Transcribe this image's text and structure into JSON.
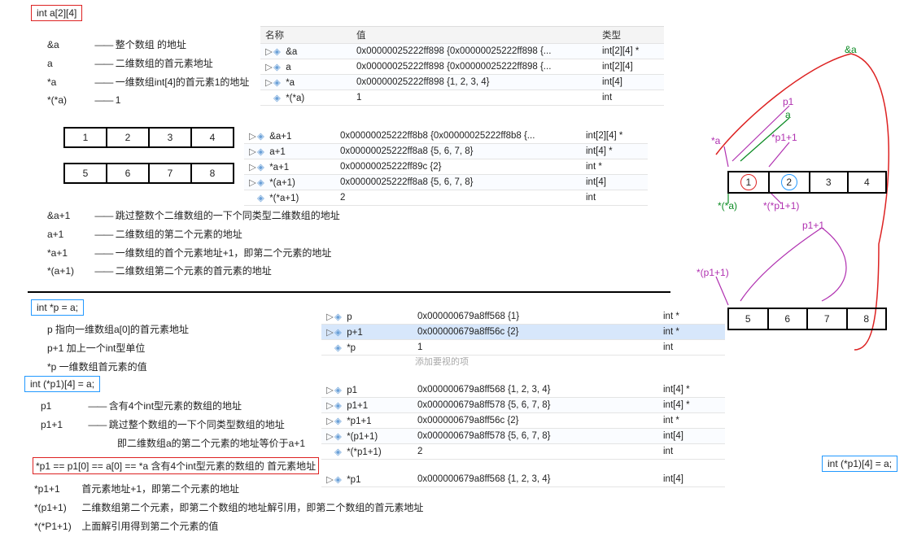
{
  "decl1": "int a[2][4]",
  "notes1": {
    "r1": {
      "sym": "&a",
      "dash": "——",
      "txt": "整个数组 的地址"
    },
    "r2": {
      "sym": "a",
      "dash": "——",
      "txt": "二维数组的首元素地址"
    },
    "r3": {
      "sym": "*a",
      "dash": "——",
      "txt": "一维数组int[4]的首元素1的地址"
    },
    "r4": {
      "sym": "*(*a)",
      "dash": "——",
      "txt": "1"
    }
  },
  "grid_a": [
    "1",
    "2",
    "3",
    "4"
  ],
  "grid_b": [
    "5",
    "6",
    "7",
    "8"
  ],
  "watch1": {
    "head": {
      "name": "名称",
      "val": "值",
      "type": "类型"
    },
    "rows": [
      {
        "name": "&a",
        "val": "0x00000025222ff898 {0x00000025222ff898 {...",
        "type": "int[2][4] *"
      },
      {
        "name": "a",
        "val": "0x00000025222ff898 {0x00000025222ff898 {...",
        "type": "int[2][4]"
      },
      {
        "name": "*a",
        "val": "0x00000025222ff898 {1, 2, 3, 4}",
        "type": "int[4]"
      },
      {
        "name": "*(*a)",
        "val": "1",
        "type": "int"
      }
    ]
  },
  "watch2": {
    "rows": [
      {
        "name": "&a+1",
        "val": "0x00000025222ff8b8 {0x00000025222ff8b8 {...",
        "type": "int[2][4] *"
      },
      {
        "name": "a+1",
        "val": "0x00000025222ff8a8 {5, 6, 7, 8}",
        "type": "int[4] *"
      },
      {
        "name": "*a+1",
        "val": "0x00000025222ff89c {2}",
        "type": "int *"
      },
      {
        "name": "*(a+1)",
        "val": "0x00000025222ff8a8 {5, 6, 7, 8}",
        "type": "int[4]"
      },
      {
        "name": "*(*a+1)",
        "val": "2",
        "type": "int"
      }
    ]
  },
  "notes2": {
    "r1": {
      "sym": "&a+1",
      "dash": "——",
      "txt": "跳过整数个二维数组的一下个同类型二维数组的地址"
    },
    "r2": {
      "sym": "a+1",
      "dash": "——",
      "txt": "二维数组的第二个元素的地址"
    },
    "r3": {
      "sym": "*a+1",
      "dash": "——",
      "txt": "一维数组的首个元素地址+1，即第二个元素的地址"
    },
    "r4": {
      "sym": "*(a+1)",
      "dash": "——",
      "txt": "二维数组第二个元素的首元素的地址"
    }
  },
  "decl2": "int *p = a;",
  "notes3": {
    "r1": "p 指向一维数组a[0]的首元素地址",
    "r2": "p+1 加上一个int型单位",
    "r3": "*p 一维数组首元素的值"
  },
  "watch3": {
    "rows": [
      {
        "name": "p",
        "val": "0x000000679a8ff568 {1}",
        "type": "int *"
      },
      {
        "name": "p+1",
        "val": "0x000000679a8ff56c {2}",
        "type": "int *",
        "sel": true
      },
      {
        "name": "*p",
        "val": "1",
        "type": "int"
      }
    ],
    "extra": "添加要视的项"
  },
  "decl3": "int (*p1)[4] = a;",
  "notes4": {
    "r1": {
      "sym": "p1",
      "dash": "——",
      "txt": "含有4个int型元素的数组的地址"
    },
    "r2a": {
      "sym": "p1+1",
      "dash": "——",
      "txt": "跳过整个数组的一下个同类型数组的地址"
    },
    "r2b": "即二维数组a的第二个元素的地址等价于a+1"
  },
  "redline": "*p1 == p1[0]  == a[0]  ==  *a    含有4个int型元素的数组的    首元素地址",
  "notes5": {
    "r1": {
      "sym": "*p1+1",
      "txt": "首元素地址+1，即第二个元素的地址"
    },
    "r2": {
      "sym": "*(p1+1)",
      "txt": "二维数组第二个元素，即第二个数组的地址解引用，即第二个数组的首元素地址"
    },
    "r3": {
      "sym": "*(*P1+1)",
      "txt": "上面解引用得到第二个元素的值"
    }
  },
  "watch4": {
    "rows": [
      {
        "name": "p1",
        "val": "0x000000679a8ff568 {1, 2, 3, 4}",
        "type": "int[4] *"
      },
      {
        "name": "p1+1",
        "val": "0x000000679a8ff578 {5, 6, 7, 8}",
        "type": "int[4] *"
      },
      {
        "name": "*p1+1",
        "val": "0x000000679a8ff56c {2}",
        "type": "int *"
      },
      {
        "name": "*(p1+1)",
        "val": "0x000000679a8ff578 {5, 6, 7, 8}",
        "type": "int[4]"
      },
      {
        "name": "*(*p1+1)",
        "val": "2",
        "type": "int"
      }
    ]
  },
  "watch5": {
    "rows": [
      {
        "name": "*p1",
        "val": "0x000000679a8ff568 {1, 2, 3, 4}",
        "type": "int[4]"
      }
    ]
  },
  "right": {
    "amp": "&a",
    "p1": "p1",
    "a": "a",
    "stara": "*a",
    "star_a": "*(*a)",
    "p1p1": "*p1+1",
    "starp11": "*(*p1+1)",
    "p1plus1": "p1+1",
    "starp1": "*(p1+1)",
    "grid_top": [
      "1",
      "2",
      "3",
      "4"
    ],
    "grid_bot": [
      "5",
      "6",
      "7",
      "8"
    ],
    "decl": "int (*p1)[4] = a;"
  }
}
